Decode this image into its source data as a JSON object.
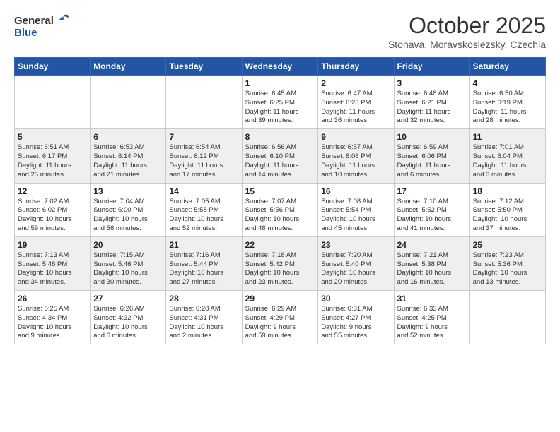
{
  "header": {
    "logo": {
      "general": "General",
      "blue": "Blue",
      "tagline": ""
    },
    "title": "October 2025",
    "location": "Stonava, Moravskoslezsky, Czechia"
  },
  "weekdays": [
    "Sunday",
    "Monday",
    "Tuesday",
    "Wednesday",
    "Thursday",
    "Friday",
    "Saturday"
  ],
  "weeks": [
    [
      {
        "day": "",
        "info": ""
      },
      {
        "day": "",
        "info": ""
      },
      {
        "day": "",
        "info": ""
      },
      {
        "day": "1",
        "info": "Sunrise: 6:45 AM\nSunset: 6:25 PM\nDaylight: 11 hours\nand 39 minutes."
      },
      {
        "day": "2",
        "info": "Sunrise: 6:47 AM\nSunset: 6:23 PM\nDaylight: 11 hours\nand 36 minutes."
      },
      {
        "day": "3",
        "info": "Sunrise: 6:48 AM\nSunset: 6:21 PM\nDaylight: 11 hours\nand 32 minutes."
      },
      {
        "day": "4",
        "info": "Sunrise: 6:50 AM\nSunset: 6:19 PM\nDaylight: 11 hours\nand 28 minutes."
      }
    ],
    [
      {
        "day": "5",
        "info": "Sunrise: 6:51 AM\nSunset: 6:17 PM\nDaylight: 11 hours\nand 25 minutes."
      },
      {
        "day": "6",
        "info": "Sunrise: 6:53 AM\nSunset: 6:14 PM\nDaylight: 11 hours\nand 21 minutes."
      },
      {
        "day": "7",
        "info": "Sunrise: 6:54 AM\nSunset: 6:12 PM\nDaylight: 11 hours\nand 17 minutes."
      },
      {
        "day": "8",
        "info": "Sunrise: 6:56 AM\nSunset: 6:10 PM\nDaylight: 11 hours\nand 14 minutes."
      },
      {
        "day": "9",
        "info": "Sunrise: 6:57 AM\nSunset: 6:08 PM\nDaylight: 11 hours\nand 10 minutes."
      },
      {
        "day": "10",
        "info": "Sunrise: 6:59 AM\nSunset: 6:06 PM\nDaylight: 11 hours\nand 6 minutes."
      },
      {
        "day": "11",
        "info": "Sunrise: 7:01 AM\nSunset: 6:04 PM\nDaylight: 11 hours\nand 3 minutes."
      }
    ],
    [
      {
        "day": "12",
        "info": "Sunrise: 7:02 AM\nSunset: 6:02 PM\nDaylight: 10 hours\nand 59 minutes."
      },
      {
        "day": "13",
        "info": "Sunrise: 7:04 AM\nSunset: 6:00 PM\nDaylight: 10 hours\nand 56 minutes."
      },
      {
        "day": "14",
        "info": "Sunrise: 7:05 AM\nSunset: 5:58 PM\nDaylight: 10 hours\nand 52 minutes."
      },
      {
        "day": "15",
        "info": "Sunrise: 7:07 AM\nSunset: 5:56 PM\nDaylight: 10 hours\nand 48 minutes."
      },
      {
        "day": "16",
        "info": "Sunrise: 7:08 AM\nSunset: 5:54 PM\nDaylight: 10 hours\nand 45 minutes."
      },
      {
        "day": "17",
        "info": "Sunrise: 7:10 AM\nSunset: 5:52 PM\nDaylight: 10 hours\nand 41 minutes."
      },
      {
        "day": "18",
        "info": "Sunrise: 7:12 AM\nSunset: 5:50 PM\nDaylight: 10 hours\nand 37 minutes."
      }
    ],
    [
      {
        "day": "19",
        "info": "Sunrise: 7:13 AM\nSunset: 5:48 PM\nDaylight: 10 hours\nand 34 minutes."
      },
      {
        "day": "20",
        "info": "Sunrise: 7:15 AM\nSunset: 5:46 PM\nDaylight: 10 hours\nand 30 minutes."
      },
      {
        "day": "21",
        "info": "Sunrise: 7:16 AM\nSunset: 5:44 PM\nDaylight: 10 hours\nand 27 minutes."
      },
      {
        "day": "22",
        "info": "Sunrise: 7:18 AM\nSunset: 5:42 PM\nDaylight: 10 hours\nand 23 minutes."
      },
      {
        "day": "23",
        "info": "Sunrise: 7:20 AM\nSunset: 5:40 PM\nDaylight: 10 hours\nand 20 minutes."
      },
      {
        "day": "24",
        "info": "Sunrise: 7:21 AM\nSunset: 5:38 PM\nDaylight: 10 hours\nand 16 minutes."
      },
      {
        "day": "25",
        "info": "Sunrise: 7:23 AM\nSunset: 5:36 PM\nDaylight: 10 hours\nand 13 minutes."
      }
    ],
    [
      {
        "day": "26",
        "info": "Sunrise: 6:25 AM\nSunset: 4:34 PM\nDaylight: 10 hours\nand 9 minutes."
      },
      {
        "day": "27",
        "info": "Sunrise: 6:26 AM\nSunset: 4:32 PM\nDaylight: 10 hours\nand 6 minutes."
      },
      {
        "day": "28",
        "info": "Sunrise: 6:28 AM\nSunset: 4:31 PM\nDaylight: 10 hours\nand 2 minutes."
      },
      {
        "day": "29",
        "info": "Sunrise: 6:29 AM\nSunset: 4:29 PM\nDaylight: 9 hours\nand 59 minutes."
      },
      {
        "day": "30",
        "info": "Sunrise: 6:31 AM\nSunset: 4:27 PM\nDaylight: 9 hours\nand 55 minutes."
      },
      {
        "day": "31",
        "info": "Sunrise: 6:33 AM\nSunset: 4:25 PM\nDaylight: 9 hours\nand 52 minutes."
      },
      {
        "day": "",
        "info": ""
      }
    ]
  ]
}
